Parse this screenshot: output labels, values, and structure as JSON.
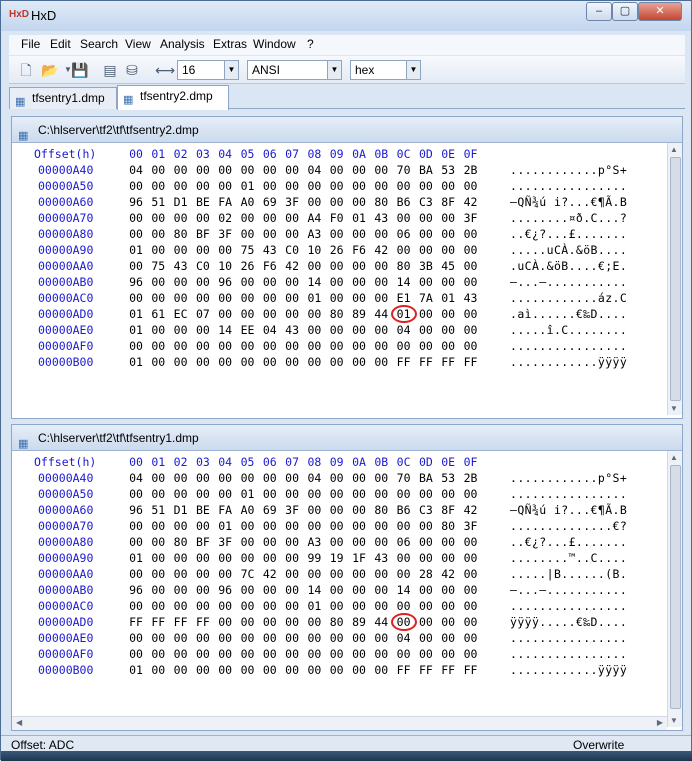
{
  "window": {
    "title": "HxD",
    "app_icon": "HxD"
  },
  "menu": [
    "File",
    "Edit",
    "Search",
    "View",
    "Analysis",
    "Extras",
    "Window",
    "?"
  ],
  "toolbar": {
    "bytes_per_row": "16",
    "charset": "ANSI",
    "offset_base": "hex"
  },
  "tabs": [
    {
      "label": "tfsentry1.dmp",
      "active": false
    },
    {
      "label": "tfsentry2.dmp",
      "active": true
    }
  ],
  "columns": {
    "offset_label": "Offset(h)",
    "headers": [
      "00",
      "01",
      "02",
      "03",
      "04",
      "05",
      "06",
      "07",
      "08",
      "09",
      "0A",
      "0B",
      "0C",
      "0D",
      "0E",
      "0F"
    ]
  },
  "panes": [
    {
      "path": "C:\\hlserver\\tf2\\tf\\tfsentry2.dmp",
      "highlight": {
        "row": 9,
        "col": 11
      },
      "rows": [
        {
          "offset": "00000A40",
          "bytes": [
            "04",
            "00",
            "00",
            "00",
            "00",
            "00",
            "00",
            "00",
            "04",
            "00",
            "00",
            "00",
            "70",
            "BA",
            "53",
            "2B"
          ],
          "text": "............p°S+"
        },
        {
          "offset": "00000A50",
          "bytes": [
            "00",
            "00",
            "00",
            "00",
            "00",
            "01",
            "00",
            "00",
            "00",
            "00",
            "00",
            "00",
            "00",
            "00",
            "00",
            "00"
          ],
          "text": "................"
        },
        {
          "offset": "00000A60",
          "bytes": [
            "96",
            "51",
            "D1",
            "BE",
            "FA",
            "A0",
            "69",
            "3F",
            "00",
            "00",
            "00",
            "80",
            "B6",
            "C3",
            "8F",
            "42"
          ],
          "text": "–QÑ¾ú i?...€¶Ã.B"
        },
        {
          "offset": "00000A70",
          "bytes": [
            "00",
            "00",
            "00",
            "00",
            "02",
            "00",
            "00",
            "00",
            "A4",
            "F0",
            "01",
            "43",
            "00",
            "00",
            "00",
            "3F"
          ],
          "text": "........¤ð.C...?"
        },
        {
          "offset": "00000A80",
          "bytes": [
            "00",
            "00",
            "80",
            "BF",
            "3F",
            "00",
            "00",
            "00",
            "A3",
            "00",
            "00",
            "00",
            "06",
            "00",
            "00",
            "00"
          ],
          "text": "..€¿?...£......."
        },
        {
          "offset": "00000A90",
          "bytes": [
            "01",
            "00",
            "00",
            "00",
            "00",
            "75",
            "43",
            "C0",
            "10",
            "26",
            "F6",
            "42",
            "00",
            "00",
            "00",
            "00"
          ],
          "text": ".....uCÀ.&öB...."
        },
        {
          "offset": "00000AA0",
          "bytes": [
            "00",
            "75",
            "43",
            "C0",
            "10",
            "26",
            "F6",
            "42",
            "00",
            "00",
            "00",
            "00",
            "80",
            "3B",
            "45",
            "00"
          ],
          "text": ".uCÀ.&öB....€;E."
        },
        {
          "offset": "00000AB0",
          "bytes": [
            "96",
            "00",
            "00",
            "00",
            "96",
            "00",
            "00",
            "00",
            "14",
            "00",
            "00",
            "00",
            "14",
            "00",
            "00",
            "00"
          ],
          "text": "–...–..........."
        },
        {
          "offset": "00000AC0",
          "bytes": [
            "00",
            "00",
            "00",
            "00",
            "00",
            "00",
            "00",
            "00",
            "01",
            "00",
            "00",
            "00",
            "E1",
            "7A",
            "01",
            "43"
          ],
          "text": "............áz.C"
        },
        {
          "offset": "00000AD0",
          "bytes": [
            "01",
            "61",
            "EC",
            "07",
            "00",
            "00",
            "00",
            "00",
            "00",
            "80",
            "89",
            "44",
            "01",
            "00",
            "00",
            "00"
          ],
          "text": ".aì......€‰D...."
        },
        {
          "offset": "00000AE0",
          "bytes": [
            "01",
            "00",
            "00",
            "00",
            "14",
            "EE",
            "04",
            "43",
            "00",
            "00",
            "00",
            "00",
            "04",
            "00",
            "00",
            "00"
          ],
          "text": ".....î.C........"
        },
        {
          "offset": "00000AF0",
          "bytes": [
            "00",
            "00",
            "00",
            "00",
            "00",
            "00",
            "00",
            "00",
            "00",
            "00",
            "00",
            "00",
            "00",
            "00",
            "00",
            "00"
          ],
          "text": "................"
        },
        {
          "offset": "00000B00",
          "bytes": [
            "01",
            "00",
            "00",
            "00",
            "00",
            "00",
            "00",
            "00",
            "00",
            "00",
            "00",
            "00",
            "FF",
            "FF",
            "FF",
            "FF"
          ],
          "text": "............ÿÿÿÿ"
        }
      ]
    },
    {
      "path": "C:\\hlserver\\tf2\\tf\\tfsentry1.dmp",
      "highlight": {
        "row": 9,
        "col": 11
      },
      "rows": [
        {
          "offset": "00000A40",
          "bytes": [
            "04",
            "00",
            "00",
            "00",
            "00",
            "00",
            "00",
            "00",
            "04",
            "00",
            "00",
            "00",
            "70",
            "BA",
            "53",
            "2B"
          ],
          "text": "............p°S+"
        },
        {
          "offset": "00000A50",
          "bytes": [
            "00",
            "00",
            "00",
            "00",
            "00",
            "01",
            "00",
            "00",
            "00",
            "00",
            "00",
            "00",
            "00",
            "00",
            "00",
            "00"
          ],
          "text": "................"
        },
        {
          "offset": "00000A60",
          "bytes": [
            "96",
            "51",
            "D1",
            "BE",
            "FA",
            "A0",
            "69",
            "3F",
            "00",
            "00",
            "00",
            "80",
            "B6",
            "C3",
            "8F",
            "42"
          ],
          "text": "–QÑ¾ú i?...€¶Ã.B"
        },
        {
          "offset": "00000A70",
          "bytes": [
            "00",
            "00",
            "00",
            "00",
            "01",
            "00",
            "00",
            "00",
            "00",
            "00",
            "00",
            "00",
            "00",
            "00",
            "80",
            "3F"
          ],
          "text": "..............€?"
        },
        {
          "offset": "00000A80",
          "bytes": [
            "00",
            "00",
            "80",
            "BF",
            "3F",
            "00",
            "00",
            "00",
            "A3",
            "00",
            "00",
            "00",
            "06",
            "00",
            "00",
            "00"
          ],
          "text": "..€¿?...£......."
        },
        {
          "offset": "00000A90",
          "bytes": [
            "01",
            "00",
            "00",
            "00",
            "00",
            "00",
            "00",
            "00",
            "99",
            "19",
            "1F",
            "43",
            "00",
            "00",
            "00",
            "00"
          ],
          "text": "........™..C...."
        },
        {
          "offset": "00000AA0",
          "bytes": [
            "00",
            "00",
            "00",
            "00",
            "00",
            "7C",
            "42",
            "00",
            "00",
            "00",
            "00",
            "00",
            "00",
            "28",
            "42",
            "00"
          ],
          "text": ".....|B......(B."
        },
        {
          "offset": "00000AB0",
          "bytes": [
            "96",
            "00",
            "00",
            "00",
            "96",
            "00",
            "00",
            "00",
            "14",
            "00",
            "00",
            "00",
            "14",
            "00",
            "00",
            "00"
          ],
          "text": "–...–..........."
        },
        {
          "offset": "00000AC0",
          "bytes": [
            "00",
            "00",
            "00",
            "00",
            "00",
            "00",
            "00",
            "00",
            "01",
            "00",
            "00",
            "00",
            "00",
            "00",
            "00",
            "00"
          ],
          "text": "................"
        },
        {
          "offset": "00000AD0",
          "bytes": [
            "FF",
            "FF",
            "FF",
            "FF",
            "00",
            "00",
            "00",
            "00",
            "00",
            "80",
            "89",
            "44",
            "00",
            "00",
            "00",
            "00"
          ],
          "text": "ÿÿÿÿ.....€‰D...."
        },
        {
          "offset": "00000AE0",
          "bytes": [
            "00",
            "00",
            "00",
            "00",
            "00",
            "00",
            "00",
            "00",
            "00",
            "00",
            "00",
            "00",
            "04",
            "00",
            "00",
            "00"
          ],
          "text": "................"
        },
        {
          "offset": "00000AF0",
          "bytes": [
            "00",
            "00",
            "00",
            "00",
            "00",
            "00",
            "00",
            "00",
            "00",
            "00",
            "00",
            "00",
            "00",
            "00",
            "00",
            "00"
          ],
          "text": "................"
        },
        {
          "offset": "00000B00",
          "bytes": [
            "01",
            "00",
            "00",
            "00",
            "00",
            "00",
            "00",
            "00",
            "00",
            "00",
            "00",
            "00",
            "FF",
            "FF",
            "FF",
            "FF"
          ],
          "text": "............ÿÿÿÿ"
        }
      ]
    }
  ],
  "status": {
    "offset": "Offset: ADC",
    "mode": "Overwrite"
  },
  "colors": {
    "offset_blue": "#1a1ad1",
    "highlight_circle": "#dd2222"
  }
}
